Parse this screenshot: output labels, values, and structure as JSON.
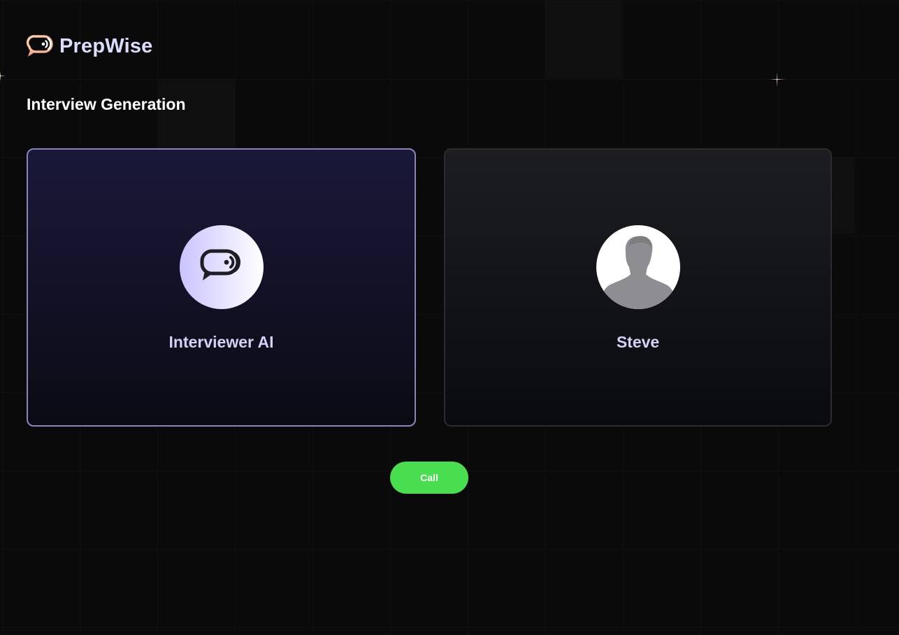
{
  "brand": {
    "name": "PrepWise",
    "logo_icon": "chat-bubble-signal-icon",
    "accent_color": "#dcdcff"
  },
  "page": {
    "title": "Interview Generation"
  },
  "interviewer_card": {
    "name": "Interviewer AI",
    "icon": "chat-bubble-signal-icon",
    "border_color": "#8a84b8"
  },
  "user_card": {
    "name": "Steve",
    "icon": "user-silhouette-icon"
  },
  "call_button": {
    "label": "Call",
    "color": "#49de50"
  }
}
